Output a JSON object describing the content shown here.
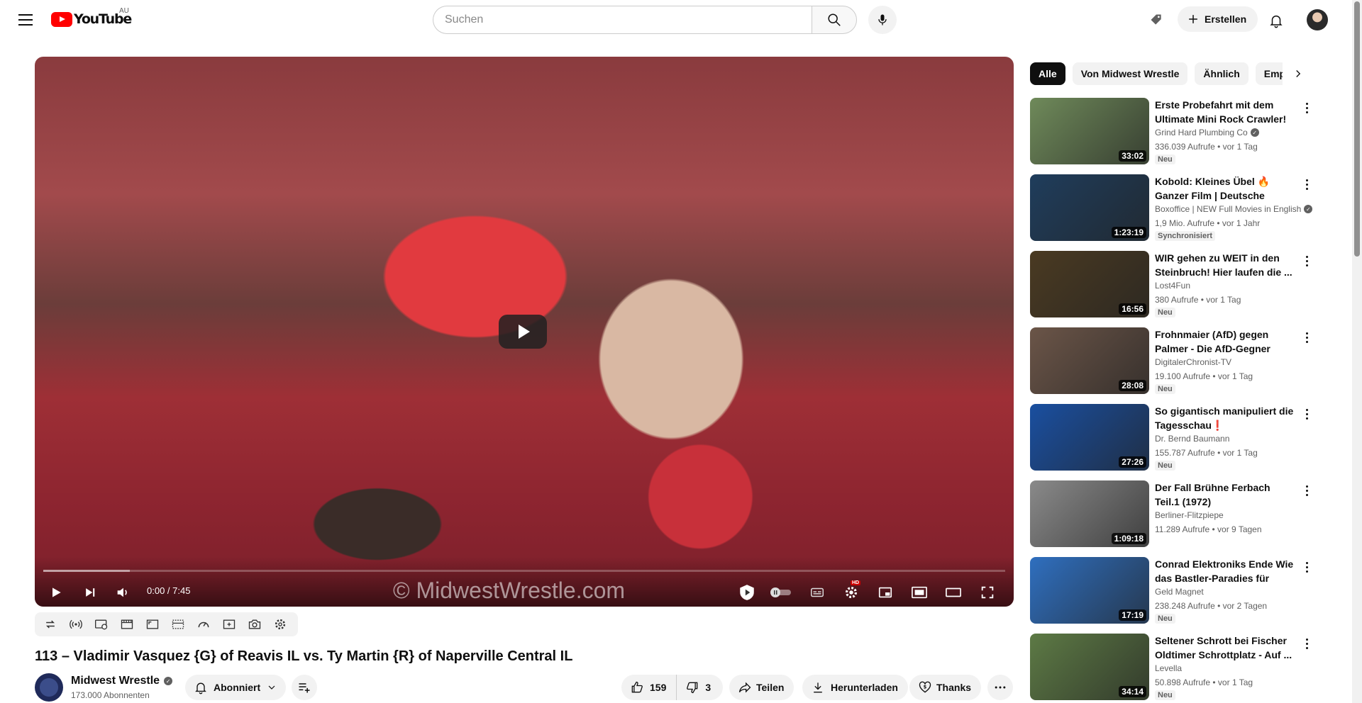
{
  "header": {
    "logo_text": "YouTube",
    "country_code": "AU",
    "search_placeholder": "Suchen",
    "create_label": "Erstellen"
  },
  "player": {
    "watermark": "© MidwestWrestle.com",
    "time": "0:00 / 7:45",
    "hd_badge": "HD",
    "buffered_fraction": 0.09
  },
  "video": {
    "title": "113 – Vladimir Vasquez {G} of Reavis IL vs. Ty Martin {R} of Naperville Central IL",
    "channel": "Midwest Wrestle",
    "subscribers": "173.000 Abonnenten",
    "subscribe_label": "Abonniert",
    "likes": "159",
    "dislikes": "3",
    "share_label": "Teilen",
    "download_label": "Herunterladen",
    "thanks_label": "Thanks"
  },
  "sidebar": {
    "chips": [
      {
        "label": "Alle",
        "active": true
      },
      {
        "label": "Von Midwest Wrestle",
        "active": false
      },
      {
        "label": "Ähnlich",
        "active": false
      },
      {
        "label": "Empfe",
        "active": false
      }
    ],
    "recommendations": [
      {
        "title": "Erste Probefahrt mit dem Ultimate Mini Rock Crawler!",
        "channel": "Grind Hard Plumbing Co",
        "verified": true,
        "meta": "336.039 Aufrufe • vor 1 Tag",
        "badge": "Neu",
        "duration": "33:02",
        "thumb_color": "#6f8a5a"
      },
      {
        "title": "Kobold: Kleines Übel 🔥 Ganzer Film | Deutsche Untertitel | Fil...",
        "channel": "Boxoffice | NEW Full Movies in English",
        "verified": true,
        "meta": "1,9 Mio. Aufrufe • vor 1 Jahr",
        "badge": "Synchronisiert",
        "duration": "1:23:19",
        "thumb_color": "#1f3d5c"
      },
      {
        "title": "WIR gehen zu WEIT in den Steinbruch! Hier laufen die ...",
        "channel": "Lost4Fun",
        "verified": false,
        "meta": "380 Aufrufe • vor 1 Tag",
        "badge": "Neu",
        "duration": "16:56",
        "thumb_color": "#4a3a22"
      },
      {
        "title": "Frohnmaier (AfD) gegen Palmer - Die AfD-Gegner verlieren jetz...",
        "channel": "DigitalerChronist-TV",
        "verified": false,
        "meta": "19.100 Aufrufe • vor 1 Tag",
        "badge": "Neu",
        "duration": "28:08",
        "thumb_color": "#6b5548"
      },
      {
        "title": "So gigantisch manipuliert die Tagesschau❗",
        "channel": "Dr. Bernd Baumann",
        "verified": false,
        "meta": "155.787 Aufrufe • vor 1 Tag",
        "badge": "Neu",
        "duration": "27:26",
        "thumb_color": "#1a4fa0"
      },
      {
        "title": "Der Fall Brühne Ferbach  Teil.1 (1972)",
        "channel": "Berliner-Flitzpiepe",
        "verified": false,
        "meta": "11.289 Aufrufe • vor 9 Tagen",
        "badge": "",
        "duration": "1:09:18",
        "thumb_color": "#8a8a8a"
      },
      {
        "title": "Conrad Elektroniks Ende Wie das Bastler-Paradies für imme...",
        "channel": "Geld Magnet",
        "verified": false,
        "meta": "238.248 Aufrufe • vor 2 Tagen",
        "badge": "Neu",
        "duration": "17:19",
        "thumb_color": "#2f6fbf"
      },
      {
        "title": "Seltener Schrott bei Fischer Oldtimer Schrottplatz - Auf ...",
        "channel": "Levella",
        "verified": false,
        "meta": "50.898 Aufrufe • vor 1 Tag",
        "badge": "Neu",
        "duration": "34:14",
        "thumb_color": "#5d7a45"
      }
    ]
  }
}
